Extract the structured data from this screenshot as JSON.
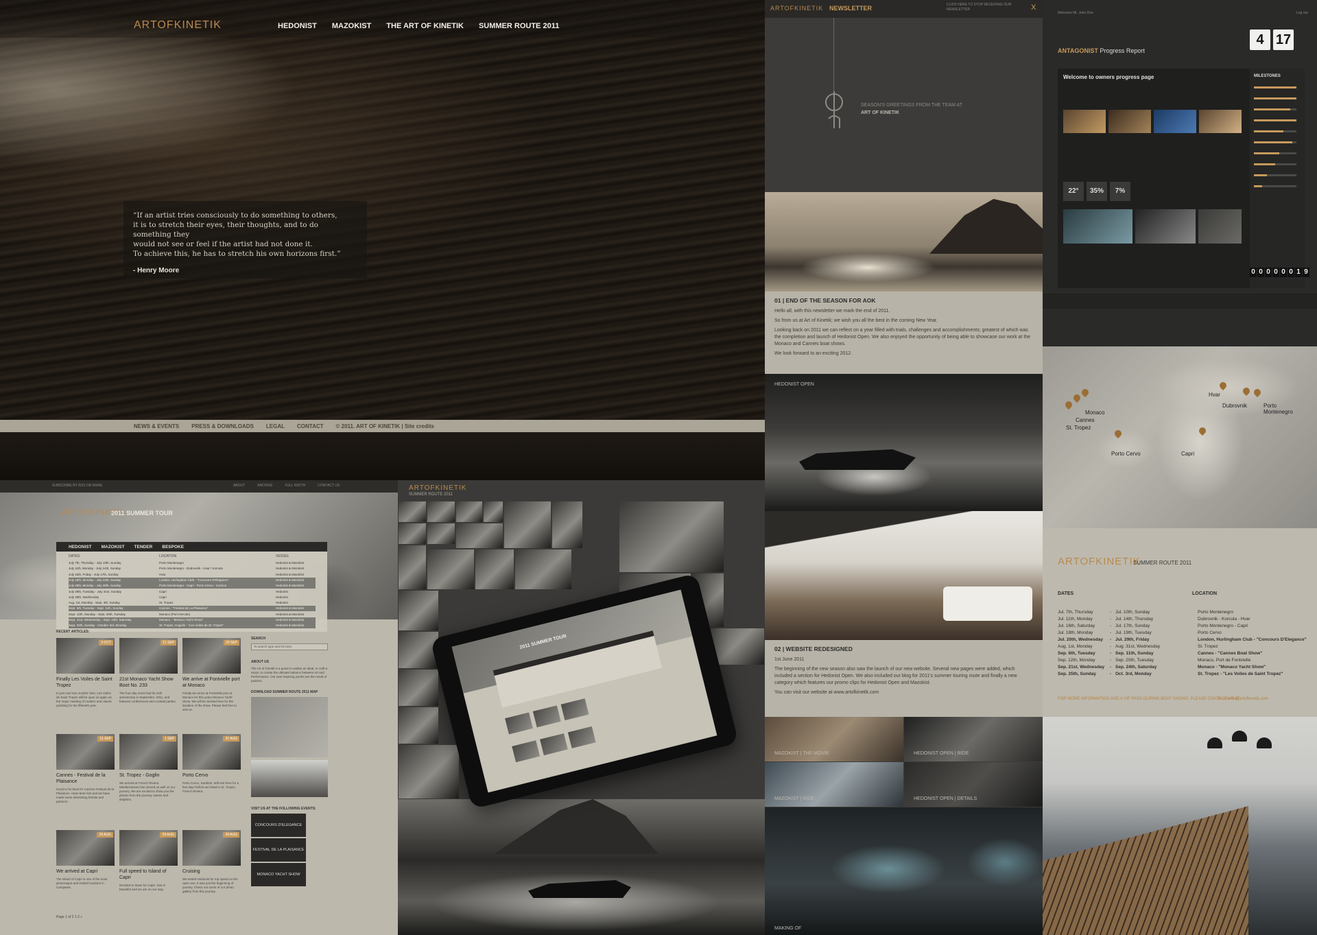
{
  "hero": {
    "brand": "ARTOFKINETIK",
    "nav": [
      "HEDONIST",
      "MAZOKIST",
      "THE ART OF KINETIK",
      "SUMMER ROUTE 2011"
    ],
    "quote_lines": [
      "“If an artist tries consciously to do something to others,",
      "it is to stretch their eyes, their thoughts, and to do something they",
      "would not see or feel if the artist had not done it.",
      "To achieve this, he has to stretch his own horizons first.”"
    ],
    "quote_author": "- Henry Moore",
    "footer": [
      "NEWS & EVENTS",
      "PRESS & DOWNLOADS",
      "LEGAL",
      "CONTACT",
      "© 2011. ART OF KINETIK  |  Site credits"
    ]
  },
  "newsletter": {
    "brand": "ARTOFKINETIK",
    "title": "NEWSLETTER",
    "stop": "CLICK HERE TO STOP RECEIVING OUR NEWSLETTER",
    "close": "X",
    "greeting_1": "SEASON'S GREETINGS FROM THE TEAM AT",
    "greeting_2": "ART OF KINETIK",
    "s1_title": "01 |    END OF THE SEASON FOR AOK",
    "s1_paras": [
      "Hello all, with this newsletter we mark the end of 2011.",
      "So from us at Art of Kinetik; we wish you all the best in the coming New Year.",
      "Looking back on 2011 we can reflect on a year filled with trials, challenges and accomplishments; greatest of which was the completion and launch of Hedonist Open. We also enjoyed the opportunity of being able to showcase our work at the Monaco and Cannes boat shows.",
      "We look forward to an exciting 2012."
    ],
    "label_open": "HEDONIST OPEN",
    "s2_title": "02 |    WEBSITE REDESIGNED",
    "s2_date": "1st June 2011",
    "s2_paras": [
      "The beginning of the new season also saw the launch of our new website. Several new pages were added, which included a section for Hedonist Open. We also included our blog for 2011's summer touring route and finally a new category which features our promo clips for Hedonist Open and Mazokist.",
      "You can visit our website at www.artofkinetik.com"
    ],
    "video_labels": [
      "MAZOKIST  |  THE MOVIE",
      "HEDONIST OPEN  |  RIDE",
      "MAZOKIST  |  RIDE",
      "HEDONIST OPEN  |  DETAILS"
    ],
    "making_of": "MAKING OF"
  },
  "antagonist": {
    "welcome": "Welcome Mr. John Doe",
    "login": "Log out",
    "clock": [
      "4",
      "17"
    ],
    "brand": "ANTAGONIST",
    "report": "Progress Report",
    "wel_title": "Welcome to owners progress page",
    "milestones": "MILESTONES",
    "milestone_progress": [
      1,
      1,
      0.85,
      1,
      0.7,
      0.9,
      0.6,
      0.5,
      0.3,
      0.2
    ],
    "stats": [
      "22°",
      "35%",
      "7%"
    ],
    "counter": [
      "0",
      "0",
      "0",
      "0",
      "0",
      "0",
      "1",
      "9"
    ]
  },
  "map": {
    "cities": [
      "Monaco",
      "Cannes",
      "St. Tropez",
      "Porto Cervo",
      "Capri",
      "Hvar",
      "Dubrovnik",
      "Porto Montenegro"
    ]
  },
  "route": {
    "brand": "ARTOFKINETIK",
    "sub": "SUMMER ROUTE 2011",
    "col_dates": "DATES",
    "col_location": "LOCATION",
    "rows": [
      {
        "from": "Jul. 7th, Thursday",
        "to": "Jul. 10th, Sunday",
        "loc": "Porto Montenegro",
        "bold": false
      },
      {
        "from": "Jul. 11th, Monday",
        "to": "Jul. 14th, Thursday",
        "loc": "Dubrovnik - Korcula - Hvar",
        "bold": false
      },
      {
        "from": "Jul. 16th, Saturday",
        "to": "Jul. 17th, Sunday",
        "loc": "Porto Montenegro - Capri",
        "bold": false
      },
      {
        "from": "Jul. 18th, Monday",
        "to": "Jul. 19th, Tuesday",
        "loc": "Porto Cervo",
        "bold": false
      },
      {
        "from": "Jul. 20th, Wednesday",
        "to": "Jul. 29th, Friday",
        "loc": "London, Hurlingham Club - \"Concours D'Elegance\"",
        "bold": true
      },
      {
        "from": "Aug. 1st, Monday",
        "to": "Aug. 31st, Wednesday",
        "loc": "St. Tropez",
        "bold": false
      },
      {
        "from": "Sep. 6th, Tuesday",
        "to": "Sep. 11th, Sunday",
        "loc": "Cannes - \"Cannes Boat Show\"",
        "bold": true
      },
      {
        "from": "Sep. 12th, Monday",
        "to": "Sep. 20th, Tuesday",
        "loc": "Monaco, Port de Fontvielle",
        "bold": false
      },
      {
        "from": "Sep. 21st, Wednesday",
        "to": "Sep. 24th, Saturday",
        "loc": "Monaco - \"Monaco Yacht Show\"",
        "bold": true
      },
      {
        "from": "Sep. 25th, Sunday",
        "to": "Oct. 3rd, Monday",
        "loc": "St. Tropez - \"Les Voiles de Saint Tropez\"",
        "bold": true
      }
    ],
    "info": "FOR MORE INFORMATION AND A VIP PASS DURING BOAT SHOWS, PLEASE CONTACT US AT",
    "mail": "E. events@artofkinetik.com"
  },
  "blog": {
    "top_sub": "SUBSCRIBE BY RSS OR EMAIL",
    "top_links": [
      "ABOUT",
      "ARCHIVE",
      "FULL WIDTH",
      "CONTACT US"
    ],
    "brand": "ARTOFKINETIK",
    "tour": "2011 SUMMER TOUR",
    "tabs": [
      "HEDONIST",
      "MAZOKIST",
      "TENDER",
      "BESPOKE"
    ],
    "col_dates": "DATES",
    "col_location": "LOCATION",
    "col_vessel": "VESSEL",
    "tour_rows": [
      {
        "d": "July 7th, Thursday   -   July 10th, Sunday",
        "l": "Porto Montenegro",
        "v": "Hedonist & Mazokist",
        "dk": false
      },
      {
        "d": "July 11th, Monday   -   July 14th, Sunday",
        "l": "Porto Montenegro - Dubrovnik - Hvar / Korcula",
        "v": "Hedonist & Mazokist",
        "dk": false
      },
      {
        "d": "July 15th, Friday   -   July 17th, Sunday",
        "l": "Hvar",
        "v": "Hedonist & Mazokist",
        "dk": false
      },
      {
        "d": "July 18th, Monday   -   July 24th, Sunday",
        "l": "London, Hurlingham Club - \"Concours D'Elegance\"",
        "v": "Hedonist & Mazokist",
        "dk": true
      },
      {
        "d": "July 25th, Monday   -   July 28th, Sunday",
        "l": "Porto Montenegro - Capri - Porto Cervo - Corsica",
        "v": "Hedonist & Mazokist",
        "dk": true
      },
      {
        "d": "July 29th, Tuesday   -   July 31st, Sunday",
        "l": "Capri",
        "v": "Hedonist",
        "dk": false
      },
      {
        "d": "July 30th, Wednesday",
        "l": "Capri",
        "v": "Hedonist",
        "dk": false
      },
      {
        "d": "Aug. 1st, Monday   -   Sept. 4th, Sunday",
        "l": "St. Tropez",
        "v": "Hedonist",
        "dk": false
      },
      {
        "d": "Sept. 5th, Tuesday   -   Sept. 11th, Sunday",
        "l": "Cannes - \"Festival de La Plaisance\"",
        "v": "Hedonist & Mazokist",
        "dk": true
      },
      {
        "d": "Sept. 12th, Monday   -   Sept. 20th, Tuesday",
        "l": "Monaco (Port Hercule)",
        "v": "Hedonist & Mazokist",
        "dk": false
      },
      {
        "d": "Sept. 21st, Wednesday   -   Sept. 24th, Saturday",
        "l": "Monaco - \"Monaco Yacht Show\"",
        "v": "Hedonist & Mazokist",
        "dk": true
      },
      {
        "d": "Sept. 25th, Sunday   -   October 3rd, Monday",
        "l": "St. Tropez, Cogolin - \"Les Voiles de St. Tropez\"",
        "v": "Hedonist & Mazokist",
        "dk": true
      }
    ],
    "recent": "RECENT ARTICLES:",
    "cards": [
      {
        "t": "Finally Les Voiles de Saint Tropez",
        "date": "3 OCT",
        "d": "In just over two months' time, Les Voiles de Saint Tropez will be upon us again as the major meeting of modern and classic yachting for the fifteenth year."
      },
      {
        "t": "21st Monaco Yacht Show Boot No. 233",
        "date": "21 SEP",
        "d": "The four-day event had its 21th anniversary in September, 2011, and features conferences and cocktail parties."
      },
      {
        "t": "We arrive at Fontvielle port at Monaco",
        "date": "20 SEP",
        "d": "Finally we arrive at Fontvielle port at Monaco for this years Monaco Yacht Show. We will be docked here for the duration of the show. Please feel free to visit us."
      },
      {
        "t": "Cannes - Festival de la Plaisance",
        "date": "11 SEP",
        "d": "Good to be back for Cannes Festival de la Plaisance. Have been fair and we have made some interesting friends and partners."
      },
      {
        "t": "St. Tropez - Goglin",
        "date": "1 SEP",
        "d": "We arrived at French Riviera. Mediterranean has served us well on our journey. We are excited to show you the photos from the journey, waves and dolphins."
      },
      {
        "t": "Porto Cervo",
        "date": "31 AUG",
        "d": "Porto Cervo, Sardinia. Will rest here for a few days before we head to St. Tropez, French Riviera."
      },
      {
        "t": "We arrived at Capri",
        "date": "29 AUG",
        "d": "The island of Capri is one of the most picturesque and visited locations in Campania."
      },
      {
        "t": "Full speed to Island of Capri",
        "date": "29 AUG",
        "d": "Decided to leave for Capri. Sea is beautiful and we are on our way."
      },
      {
        "t": "Cruising",
        "date": "29 AUG",
        "d": "We tested Hedonist for top speed on the open sea. It was just the beginning of journey. Check out some of our photo gallery from this journey."
      }
    ],
    "search_label": "SEARCH",
    "search_placeholder": "To search type and hit enter",
    "about_label": "ABOUT US",
    "about_text": "The Art of Kinetik is a quest to realise an ideal, to craft a vision, to create the ultimate balance between Art and Performance. Our awe-inspiring yachts are the result of passion.",
    "download_label": "DOWNLOAD SUMMER ROUTE 2011 MAP",
    "events_label": "VISIT US AT THE FOLLOWING EVENTS:",
    "events": [
      "CONCOURS D'ELEGANCE",
      "FESTIVAL DE LA PLAISANCE",
      "MONACO YACHT SHOW"
    ],
    "pager": "Page 1 of 2   1  2  »"
  },
  "gallery": {
    "brand": "ARTOFKINETIK",
    "sub": "SUMMER ROUTE 2011",
    "tablet_title": "2011 SUMMER TOUR"
  },
  "colors": {
    "accent": "#c69a5c",
    "footer_bar": "#aaa596",
    "paper": "#bcb8ac"
  }
}
